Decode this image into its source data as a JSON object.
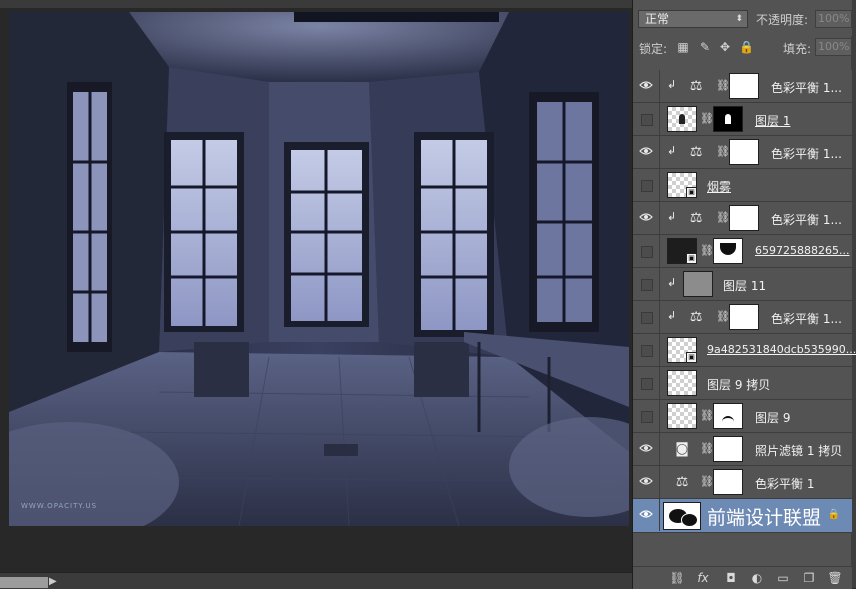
{
  "canvas": {
    "watermark": "WWW.OPACITY.US"
  },
  "layers_panel": {
    "blend_mode": "正常",
    "opacity_label": "不透明度:",
    "opacity_value": "100%",
    "lock_label": "锁定:",
    "fill_label": "填充:",
    "fill_value": "100%",
    "selection_color": "#6d8ab4",
    "layers": [
      {
        "name": "色彩平衡 1...",
        "visible": true,
        "clipped": true,
        "kind": "adjustment",
        "icon": "balance-icon"
      },
      {
        "name": "图层 1",
        "visible": false,
        "clipped": false,
        "kind": "masked-pixel"
      },
      {
        "name": "色彩平衡 1...",
        "visible": true,
        "clipped": true,
        "kind": "adjustment",
        "icon": "balance-icon"
      },
      {
        "name": "烟雾",
        "visible": false,
        "clipped": false,
        "kind": "smart-object"
      },
      {
        "name": "色彩平衡 1...",
        "visible": true,
        "clipped": true,
        "kind": "adjustment",
        "icon": "balance-icon"
      },
      {
        "name": "659725888265...",
        "visible": false,
        "clipped": false,
        "kind": "smart-object-masked"
      },
      {
        "name": "图层 11",
        "visible": false,
        "clipped": true,
        "kind": "pixel"
      },
      {
        "name": "色彩平衡 1...",
        "visible": false,
        "clipped": true,
        "kind": "adjustment",
        "icon": "balance-icon"
      },
      {
        "name": "9a482531840dcb535990...",
        "visible": false,
        "clipped": false,
        "kind": "smart-object"
      },
      {
        "name": "图层 9 拷贝",
        "visible": false,
        "clipped": false,
        "kind": "pixel"
      },
      {
        "name": "图层 9",
        "visible": false,
        "clipped": false,
        "kind": "masked-pixel"
      },
      {
        "name": "照片滤镜 1 拷贝",
        "visible": true,
        "clipped": false,
        "kind": "adjustment",
        "icon": "photo-filter-icon"
      },
      {
        "name": "色彩平衡 1",
        "visible": true,
        "clipped": false,
        "kind": "adjustment",
        "icon": "balance-icon"
      },
      {
        "name": "前端设计联盟",
        "visible": true,
        "clipped": false,
        "kind": "background",
        "selected": true,
        "locked": true
      }
    ],
    "footer_icons": [
      "link-icon",
      "fx-icon",
      "mask-icon",
      "adjustment-icon",
      "folder-icon",
      "new-layer-icon",
      "trash-icon"
    ]
  }
}
